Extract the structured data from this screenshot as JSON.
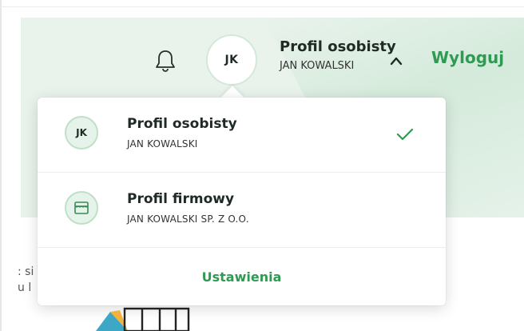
{
  "header": {
    "notifications_icon": "bell-icon",
    "avatar_initials": "JK",
    "profile_name": "Profil osobisty",
    "profile_user": "JAN KOWALSKI",
    "chevron_icon": "chevron-up-icon",
    "logout_label": "Wyloguj"
  },
  "dropdown": {
    "profiles": [
      {
        "icon_text": "JK",
        "title": "Profil osobisty",
        "subtitle": "JAN KOWALSKI",
        "selected": true
      },
      {
        "icon": "shop-icon",
        "title": "Profil firmowy",
        "subtitle": "JAN KOWALSKI SP. Z O.O.",
        "selected": false
      }
    ],
    "settings_label": "Ustawienia"
  },
  "background": {
    "text_fragment": [
      ": si",
      "u l"
    ]
  },
  "colors": {
    "accent": "#2e9a52",
    "mint_bg": "#e9f3ec",
    "icon_bg": "#e6f3ea",
    "icon_border": "#bfe0c8"
  }
}
